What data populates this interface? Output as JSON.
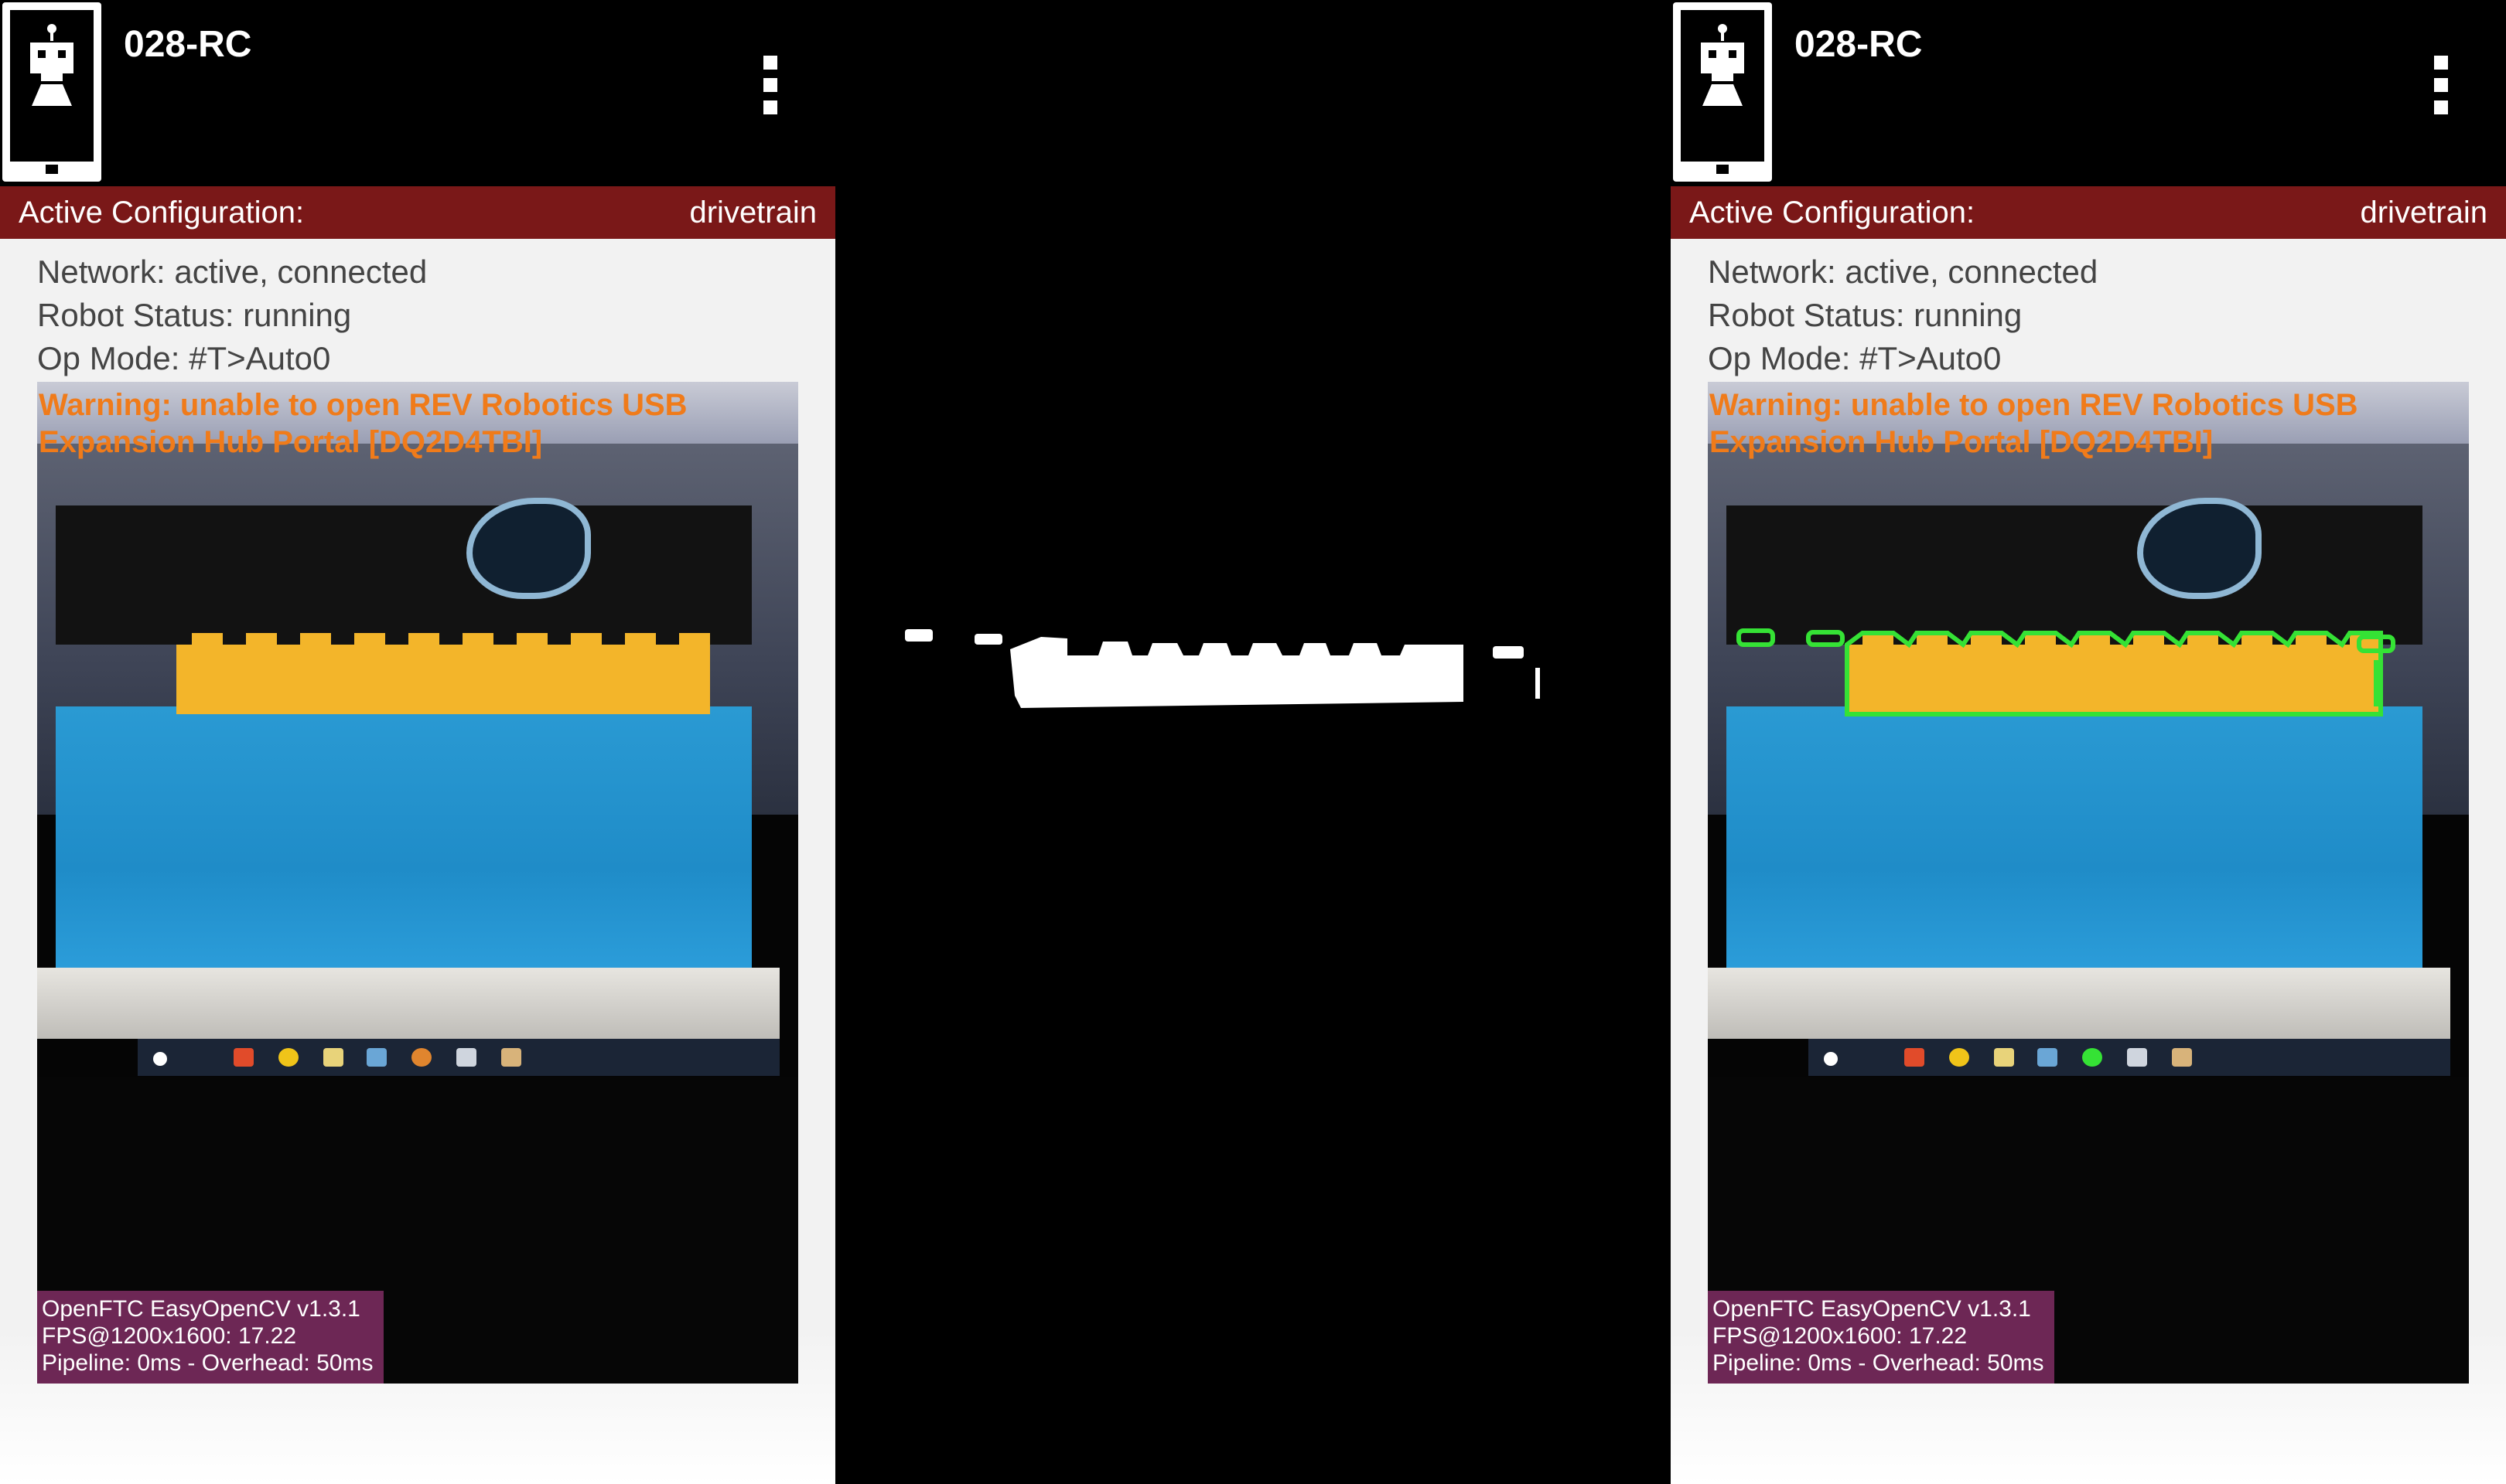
{
  "app": {
    "title": "028-RC",
    "menu_icon": "overflow-menu-icon",
    "robot_icon": "robot-phone-icon"
  },
  "config": {
    "label": "Active Configuration:",
    "value": "drivetrain"
  },
  "status": {
    "network": "Network: active, connected",
    "robot_status": "Robot Status: running",
    "op_mode": "Op Mode: #T>Auto0"
  },
  "camera": {
    "warning_line1": "Warning: unable to open REV Robotics USB",
    "warning_line2": "Expansion Hub Portal [DQ2D4TBI]",
    "overlay_line1": "OpenFTC EasyOpenCV v1.3.1",
    "overlay_line2": "FPS@1200x1600: 17.22",
    "overlay_line3": "Pipeline: 0ms - Overhead: 50ms"
  },
  "colors": {
    "config_bar": "#7a1818",
    "warning_text": "#f07b1a",
    "overlay_bg": "#6d2755",
    "contour": "#35e235",
    "stone_yellow": "#f3b52a",
    "carpet_blue": "#1f8cc8"
  }
}
